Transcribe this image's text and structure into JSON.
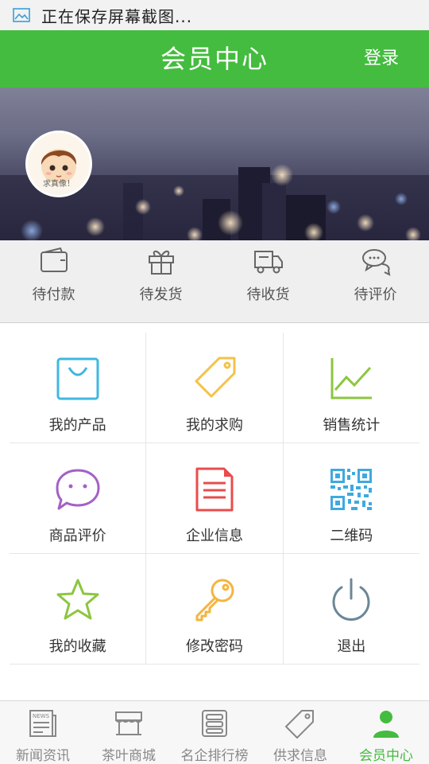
{
  "status_bar": {
    "text": "正在保存屏幕截图..."
  },
  "header": {
    "title": "会员中心",
    "login_label": "登录"
  },
  "profile": {
    "avatar_caption": "求真像！"
  },
  "orders": [
    {
      "label": "待付款",
      "icon": "wallet-icon"
    },
    {
      "label": "待发货",
      "icon": "gift-icon"
    },
    {
      "label": "待收货",
      "icon": "delivery-truck-icon"
    },
    {
      "label": "待评价",
      "icon": "chat-bubbles-icon"
    }
  ],
  "menu": [
    {
      "label": "我的产品",
      "icon": "shopping-bag-icon",
      "color": "#3fb7e0"
    },
    {
      "label": "我的求购",
      "icon": "price-tag-icon",
      "color": "#f4c24a"
    },
    {
      "label": "销售统计",
      "icon": "line-chart-icon",
      "color": "#8cc63f"
    },
    {
      "label": "商品评价",
      "icon": "comment-icon",
      "color": "#a361c7"
    },
    {
      "label": "企业信息",
      "icon": "document-icon",
      "color": "#e84c4c"
    },
    {
      "label": "二维码",
      "icon": "qr-code-icon",
      "color": "#3fa9e0"
    },
    {
      "label": "我的收藏",
      "icon": "star-icon",
      "color": "#8cc63f"
    },
    {
      "label": "修改密码",
      "icon": "key-icon",
      "color": "#f4b53f"
    },
    {
      "label": "退出",
      "icon": "power-icon",
      "color": "#6c8796"
    }
  ],
  "tabs": [
    {
      "label": "新闻资讯",
      "icon": "newspaper-icon",
      "active": false
    },
    {
      "label": "茶叶商城",
      "icon": "storefront-icon",
      "active": false
    },
    {
      "label": "名企排行榜",
      "icon": "ranking-list-icon",
      "active": false
    },
    {
      "label": "供求信息",
      "icon": "tag-icon",
      "active": false
    },
    {
      "label": "会员中心",
      "icon": "user-icon",
      "active": true
    }
  ],
  "colors": {
    "brand_green": "#44bc3f",
    "tab_inactive": "#888888"
  }
}
